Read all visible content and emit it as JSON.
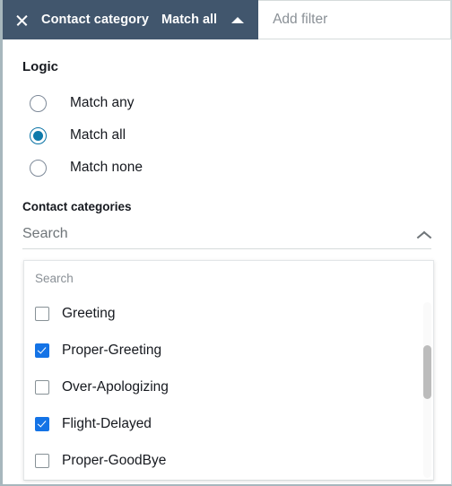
{
  "filter_bar": {
    "token": {
      "close_icon": "close-icon",
      "title": "Contact category",
      "operator": "Match all",
      "caret_icon": "caret-up-icon"
    },
    "add_filter_placeholder": "Add filter"
  },
  "logic": {
    "heading": "Logic",
    "options": [
      {
        "label": "Match any",
        "selected": false
      },
      {
        "label": "Match all",
        "selected": true
      },
      {
        "label": "Match none",
        "selected": false
      }
    ]
  },
  "contact_categories": {
    "label": "Contact categories",
    "field_placeholder": "Search",
    "expand_icon": "chevron-up-icon",
    "expanded": true,
    "dropdown": {
      "search_placeholder": "Search",
      "items": [
        {
          "label": "Greeting",
          "checked": false
        },
        {
          "label": "Proper-Greeting",
          "checked": true
        },
        {
          "label": "Over-Apologizing",
          "checked": false
        },
        {
          "label": "Flight-Delayed",
          "checked": true
        },
        {
          "label": "Proper-GoodBye",
          "checked": false
        }
      ]
    }
  },
  "colors": {
    "token_background": "#41566d",
    "radio_accent": "#0e7aab",
    "checkbox_accent": "#1473e6",
    "text_primary": "#16191f",
    "text_muted": "#8a9096",
    "border": "#d5dbdb",
    "left_rail": "#a7b7bd",
    "scrollbar_thumb": "#bcbcbc"
  }
}
